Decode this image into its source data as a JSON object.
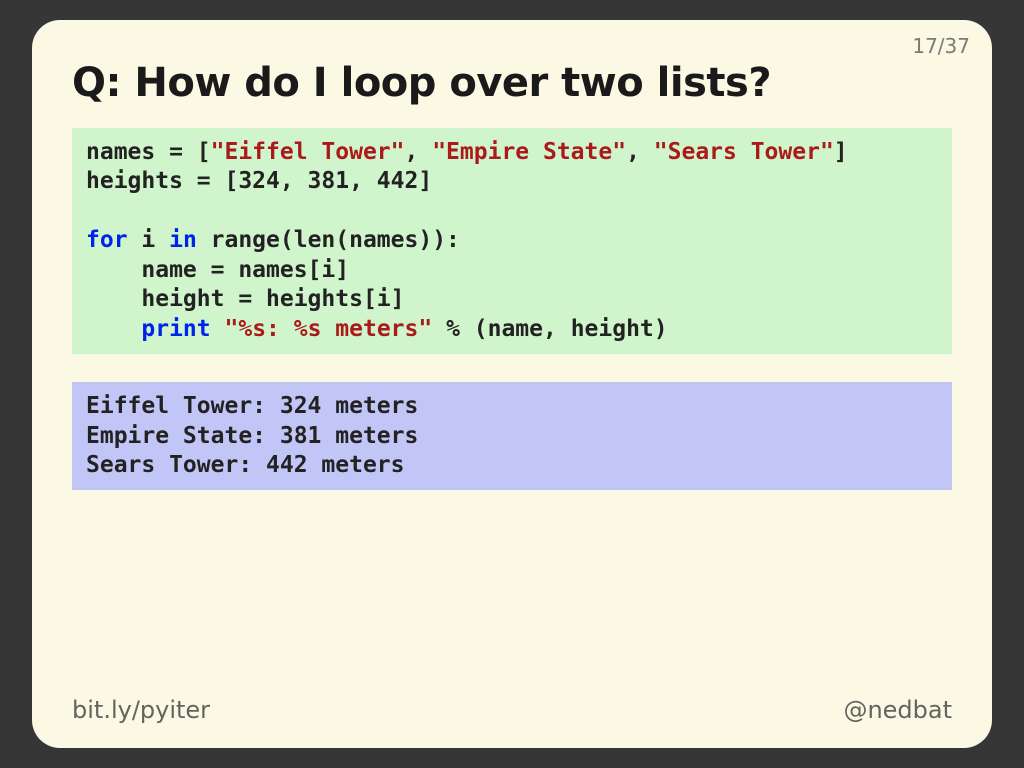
{
  "page": {
    "current": "17",
    "sep": "/",
    "total": "37"
  },
  "title": "Q: How do I loop over two lists?",
  "code": {
    "l1_a": "names = [",
    "l1_s1": "\"Eiffel Tower\"",
    "l1_b": ", ",
    "l1_s2": "\"Empire State\"",
    "l1_c": ", ",
    "l1_s3": "\"Sears Tower\"",
    "l1_d": "]",
    "l2": "heights = [324, 381, 442]",
    "l3_kw1": "for",
    "l3_a": " i ",
    "l3_kw2": "in",
    "l3_b": " range(len(names)):",
    "l4": "    name = names[i]",
    "l5": "    height = heights[i]",
    "l6_a": "    ",
    "l6_kw": "print",
    "l6_b": " ",
    "l6_s": "\"%s: %s meters\"",
    "l6_c": " % (name, height)"
  },
  "output": "Eiffel Tower: 324 meters\nEmpire State: 381 meters\nSears Tower: 442 meters",
  "footer": {
    "left": "bit.ly/pyiter",
    "right": "@nedbat"
  }
}
